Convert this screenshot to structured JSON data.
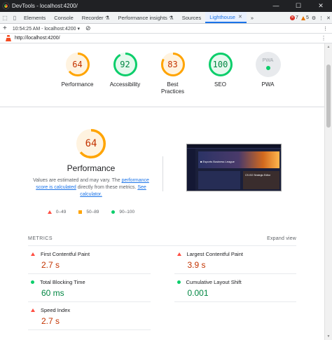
{
  "window": {
    "title": "DevTools - localhost:4200/",
    "controls": [
      "—",
      "☐",
      "✕"
    ]
  },
  "tabs": [
    {
      "label": "Elements"
    },
    {
      "label": "Console"
    },
    {
      "label": "Recorder ⚗"
    },
    {
      "label": "Performance insights ⚗"
    },
    {
      "label": "Sources"
    },
    {
      "label": "Lighthouse"
    }
  ],
  "status": {
    "errors": "7",
    "warnings": "5"
  },
  "toolbar": {
    "report_select": "10:54:25 AM - localhost:4200 ▾",
    "add": "+",
    "clear": "⊘",
    "more": "⋮"
  },
  "url": {
    "text": "http://localhost:4200/"
  },
  "colors": {
    "fail": "#ff4e42",
    "average": "#ffa400",
    "pass": "#0cce6b",
    "link": "#1a73e8"
  },
  "gauges": [
    {
      "label": "Performance",
      "score": "64",
      "fraction": 0.64,
      "color": "#ffa400",
      "text_color": "#c33300",
      "bg": "#fff3e0"
    },
    {
      "label": "Accessibility",
      "score": "92",
      "fraction": 0.92,
      "color": "#0cce6b",
      "text_color": "#018642",
      "bg": "#e6f9ee"
    },
    {
      "label": "Best Practices",
      "score": "83",
      "fraction": 0.83,
      "color": "#ffa400",
      "text_color": "#c33300",
      "bg": "#fff3e0"
    },
    {
      "label": "SEO",
      "score": "100",
      "fraction": 1.0,
      "color": "#0cce6b",
      "text_color": "#018642",
      "bg": "#e6f9ee"
    },
    {
      "label": "PWA",
      "score": "PWA"
    }
  ],
  "perf": {
    "score": "64",
    "fraction": 0.64,
    "title": "Performance",
    "desc_1": "Values are estimated and may vary. The ",
    "desc_link1": "performance score is calculated",
    "desc_2": " directly from these metrics. ",
    "desc_link2": "See calculator.",
    "legend": [
      "0–49",
      "50–89",
      "90–100"
    ]
  },
  "screenshot": {
    "hero_text": "■ Esports Business League",
    "card_text": "CS:GO Strategic Editor"
  },
  "metrics": {
    "heading": "METRICS",
    "expand": "Expand view",
    "items": [
      {
        "label": "First Contentful Paint",
        "value": "2.7 s",
        "status": "fail"
      },
      {
        "label": "Largest Contentful Paint",
        "value": "3.9 s",
        "status": "fail"
      },
      {
        "label": "Total Blocking Time",
        "value": "60 ms",
        "status": "pass"
      },
      {
        "label": "Cumulative Layout Shift",
        "value": "0.001",
        "status": "pass"
      },
      {
        "label": "Speed Index",
        "value": "2.7 s",
        "status": "fail"
      }
    ]
  }
}
